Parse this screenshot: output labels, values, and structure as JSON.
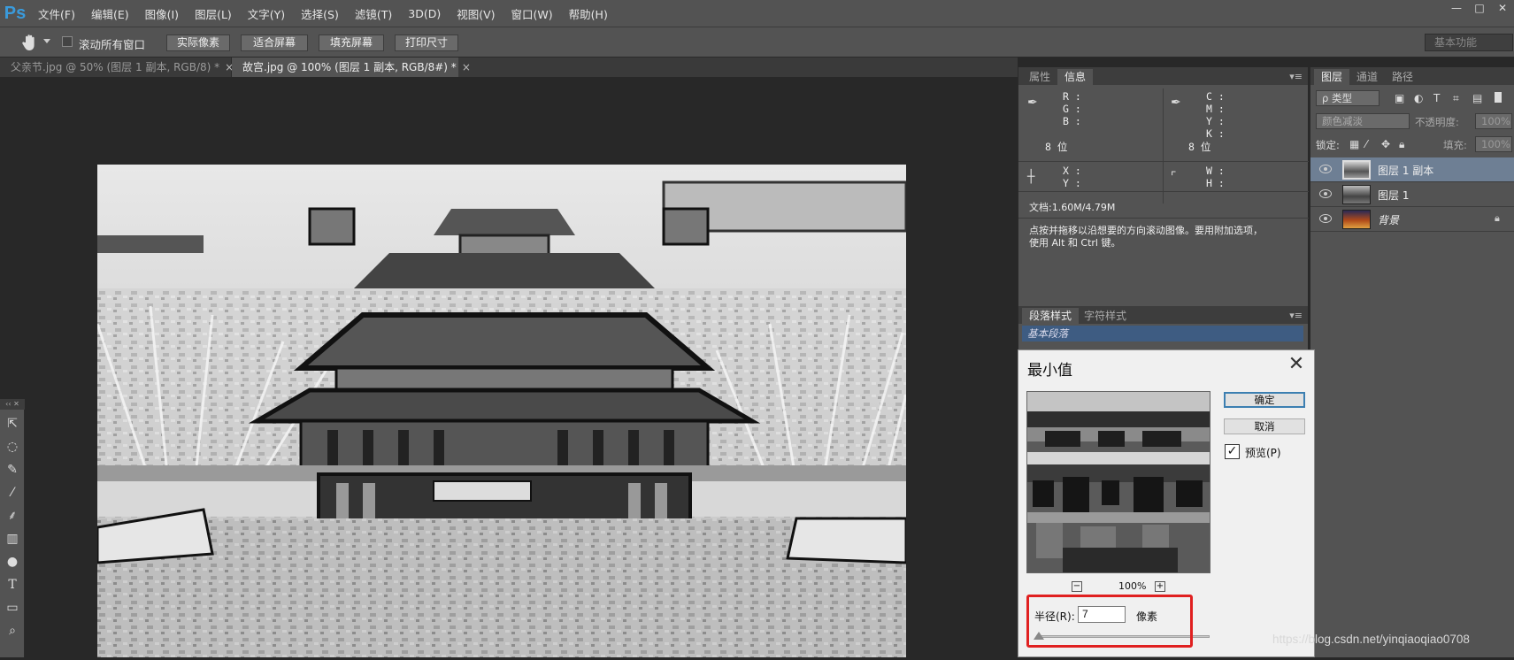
{
  "app": {
    "logo": "Ps",
    "menu": [
      "文件(F)",
      "编辑(E)",
      "图像(I)",
      "图层(L)",
      "文字(Y)",
      "选择(S)",
      "滤镜(T)",
      "3D(D)",
      "视图(V)",
      "窗口(W)",
      "帮助(H)"
    ],
    "window_controls": [
      "—",
      "□",
      "✕"
    ]
  },
  "options_bar": {
    "scroll_all_label": "滚动所有窗口",
    "buttons": [
      "实际像素",
      "适合屏幕",
      "填充屏幕",
      "打印尺寸"
    ],
    "workspace": "基本功能"
  },
  "doc_tabs": [
    {
      "title": "父亲节.jpg @ 50% (图层 1 副本, RGB/8) *",
      "active": false
    },
    {
      "title": "故宫.jpg @ 100% (图层 1 副本, RGB/8#) *",
      "active": true
    }
  ],
  "info_panel": {
    "tabs": [
      "属性",
      "信息"
    ],
    "rgb_labels": "R :\nG :\nB :",
    "cmyk_labels": "C :\nM :\nY :\nK :",
    "bits_left": "8 位",
    "bits_right": "8 位",
    "xy_labels": "X :\nY :",
    "wh_labels": "W :\nH :",
    "doc_size": "文档:1.60M/4.79M",
    "hint": "点按并拖移以沿想要的方向滚动图像。要用附加选项，\n使用 Alt 和 Ctrl 键。"
  },
  "paragraph_panel": {
    "tabs": [
      "段落样式",
      "字符样式"
    ],
    "row": "基本段落"
  },
  "layers_panel": {
    "tabs": [
      "图层",
      "通道",
      "路径"
    ],
    "filter_kind": "ρ 类型",
    "blend_mode": "颜色减淡",
    "opacity_label": "不透明度:",
    "opacity_value": "100%",
    "lock_label": "锁定:",
    "fill_label": "填充:",
    "fill_value": "100%",
    "layers": [
      {
        "name": "图层 1 副本",
        "selected": true
      },
      {
        "name": "图层 1",
        "selected": false
      },
      {
        "name": "背景",
        "selected": false
      }
    ]
  },
  "dialog": {
    "title": "最小值",
    "ok": "确定",
    "cancel": "取消",
    "preview_label": "预览(P)",
    "preview_checked": true,
    "zoom": "100%",
    "radius_label": "半径(R):",
    "radius_value": "7",
    "radius_unit": "像素"
  },
  "watermark": "https://blog.csdn.net/yinqiaoqiao0708",
  "colors": {
    "ui_panel": "#535353",
    "canvas_bg": "#282828",
    "ps_blue": "#3a9bdc",
    "highlight_red": "#e02020",
    "selected_layer": "#6e7f94"
  }
}
